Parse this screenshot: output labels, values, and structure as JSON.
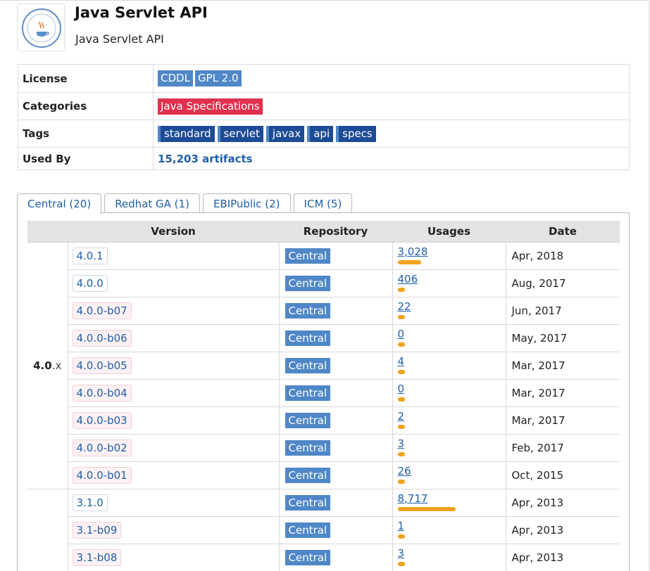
{
  "header": {
    "title": "Java Servlet API",
    "subtitle": "Java Servlet API"
  },
  "info": {
    "license_label": "License",
    "licenses": [
      "CDDL",
      "GPL 2.0"
    ],
    "categories_label": "Categories",
    "categories": [
      "Java Specifications"
    ],
    "tags_label": "Tags",
    "tags": [
      "standard",
      "servlet",
      "javax",
      "api",
      "specs"
    ],
    "used_by_label": "Used By",
    "used_by_value": "15,203 artifacts"
  },
  "tabs": [
    {
      "label": "Central (20)",
      "active": true
    },
    {
      "label": "Redhat GA (1)",
      "active": false
    },
    {
      "label": "EBIPublic (2)",
      "active": false
    },
    {
      "label": "ICM (5)",
      "active": false
    }
  ],
  "table": {
    "headers": [
      "Version",
      "Repository",
      "Usages",
      "Date"
    ],
    "groups": [
      {
        "major": "4.0",
        "suffix": ".x",
        "rows": [
          {
            "version": "4.0.1",
            "pre": false,
            "repo": "Central",
            "usages": "3,028",
            "usage_bar_fraction": 0.4,
            "date": "Apr, 2018"
          },
          {
            "version": "4.0.0",
            "pre": false,
            "repo": "Central",
            "usages": "406",
            "usage_bar_fraction": 0.05,
            "date": "Aug, 2017"
          },
          {
            "version": "4.0.0-b07",
            "pre": true,
            "repo": "Central",
            "usages": "22",
            "usage_bar_fraction": 0.01,
            "date": "Jun, 2017"
          },
          {
            "version": "4.0.0-b06",
            "pre": true,
            "repo": "Central",
            "usages": "0",
            "usage_bar_fraction": 0.0,
            "date": "May, 2017"
          },
          {
            "version": "4.0.0-b05",
            "pre": true,
            "repo": "Central",
            "usages": "4",
            "usage_bar_fraction": 0.0,
            "date": "Mar, 2017"
          },
          {
            "version": "4.0.0-b04",
            "pre": true,
            "repo": "Central",
            "usages": "0",
            "usage_bar_fraction": 0.0,
            "date": "Mar, 2017"
          },
          {
            "version": "4.0.0-b03",
            "pre": true,
            "repo": "Central",
            "usages": "2",
            "usage_bar_fraction": 0.0,
            "date": "Mar, 2017"
          },
          {
            "version": "4.0.0-b02",
            "pre": true,
            "repo": "Central",
            "usages": "3",
            "usage_bar_fraction": 0.0,
            "date": "Feb, 2017"
          },
          {
            "version": "4.0.0-b01",
            "pre": true,
            "repo": "Central",
            "usages": "26",
            "usage_bar_fraction": 0.01,
            "date": "Oct, 2015"
          }
        ]
      },
      {
        "major": "",
        "suffix": "",
        "rows": [
          {
            "version": "3.1.0",
            "pre": false,
            "repo": "Central",
            "usages": "8,717",
            "usage_bar_fraction": 1.0,
            "date": "Apr, 2013"
          },
          {
            "version": "3.1-b09",
            "pre": true,
            "repo": "Central",
            "usages": "1",
            "usage_bar_fraction": 0.0,
            "date": "Apr, 2013"
          },
          {
            "version": "3.1-b08",
            "pre": true,
            "repo": "Central",
            "usages": "3",
            "usage_bar_fraction": 0.0,
            "date": "Apr, 2013"
          }
        ]
      }
    ]
  },
  "colors": {
    "link": "#1f5fa8",
    "license_badge": "#4f87c7",
    "category_badge": "#e0314f",
    "tag_badge": "#1d4b95",
    "usage_bar": "#f0a31a"
  },
  "icons": {
    "logo": "java-community-process-logo"
  }
}
